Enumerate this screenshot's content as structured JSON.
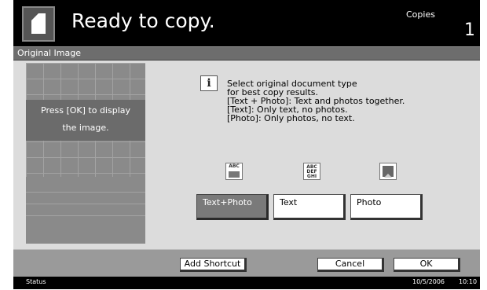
{
  "header": {
    "title": "Ready to copy.",
    "copies_label": "Copies",
    "copies_value": "1"
  },
  "section": {
    "title": "Original Image"
  },
  "preview": {
    "line1": "Press [OK] to display",
    "line2": "the image."
  },
  "info": {
    "icon_glyph": "i",
    "lines": [
      "Select original document type",
      "for best copy results.",
      "[Text + Photo]: Text and photos together.",
      "[Text]: Only text, no photos.",
      "[Photo]: Only photos, no text."
    ]
  },
  "options": [
    {
      "label": "Text+Photo",
      "icon": "text-photo-icon",
      "icon_text": "ABC",
      "selected": true
    },
    {
      "label": "Text",
      "icon": "text-icon",
      "icon_text_lines": [
        "ABC",
        "DEF",
        "GHI"
      ],
      "selected": false
    },
    {
      "label": "Photo",
      "icon": "photo-icon",
      "selected": false
    }
  ],
  "bottom": {
    "add_shortcut": "Add Shortcut",
    "cancel": "Cancel",
    "ok": "OK"
  },
  "status": {
    "label": "Status",
    "date": "10/5/2006",
    "time": "10:10"
  }
}
